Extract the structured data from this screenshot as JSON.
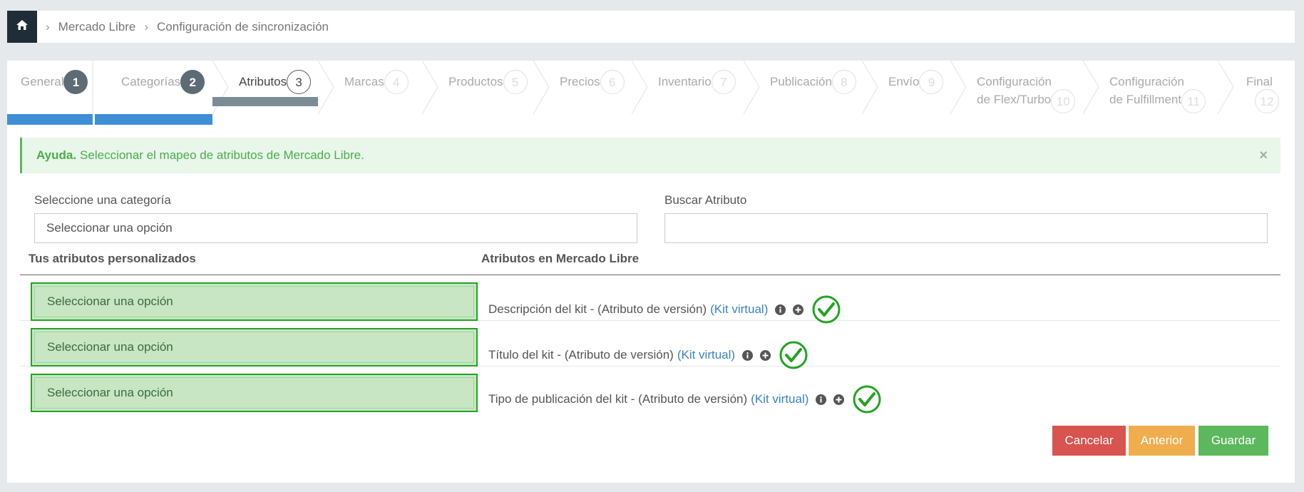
{
  "breadcrumb": {
    "home_icon": "home-icon",
    "items": [
      "Mercado Libre",
      "Configuración de sincronización"
    ]
  },
  "wizard": {
    "steps": [
      {
        "label": "General",
        "num": "1",
        "state": "done"
      },
      {
        "label": "Categorías",
        "num": "2",
        "state": "done"
      },
      {
        "label": "Atributos",
        "num": "3",
        "state": "active"
      },
      {
        "label": "Marcas",
        "num": "4",
        "state": "pending"
      },
      {
        "label": "Productos",
        "num": "5",
        "state": "pending"
      },
      {
        "label": "Precios",
        "num": "6",
        "state": "pending"
      },
      {
        "label": "Inventario",
        "num": "7",
        "state": "pending"
      },
      {
        "label": "Publicación",
        "num": "8",
        "state": "pending"
      },
      {
        "label": "Envío",
        "num": "9",
        "state": "pending"
      },
      {
        "label": "Configuración",
        "label2": "de Flex/Turbo",
        "num": "10",
        "state": "pending"
      },
      {
        "label": "Configuración",
        "label2": "de Fulfillment",
        "num": "11",
        "state": "pending"
      },
      {
        "label": "Final",
        "num": "12",
        "state": "pending"
      }
    ]
  },
  "alert": {
    "title": "Ayuda.",
    "message": "Seleccionar el mapeo de atributos de Mercado Libre.",
    "close": "×"
  },
  "filters": {
    "category_label": "Seleccione una categoría",
    "category_value": "Seleccionar una opción",
    "search_label": "Buscar Atributo",
    "search_value": ""
  },
  "table": {
    "col_custom": "Tus atributos personalizados",
    "col_ml": "Atributos en Mercado Libre",
    "rows": [
      {
        "select": "Seleccionar una opción",
        "attr": "Descripción del kit - (Atributo de versión)",
        "kit": "(Kit virtual)"
      },
      {
        "select": "Seleccionar una opción",
        "attr": "Título del kit - (Atributo de versión)",
        "kit": "(Kit virtual)"
      },
      {
        "select": "Seleccionar una opción",
        "attr": "Tipo de publicación del kit - (Atributo de versión)",
        "kit": "(Kit virtual)"
      }
    ]
  },
  "buttons": {
    "cancel": "Cancelar",
    "prev": "Anterior",
    "save": "Guardar"
  },
  "colors": {
    "cancel": "#d9534f",
    "prev": "#f0ad4e",
    "save": "#5cb85c",
    "progress": "#3f8fd6",
    "check": "#22a322"
  }
}
